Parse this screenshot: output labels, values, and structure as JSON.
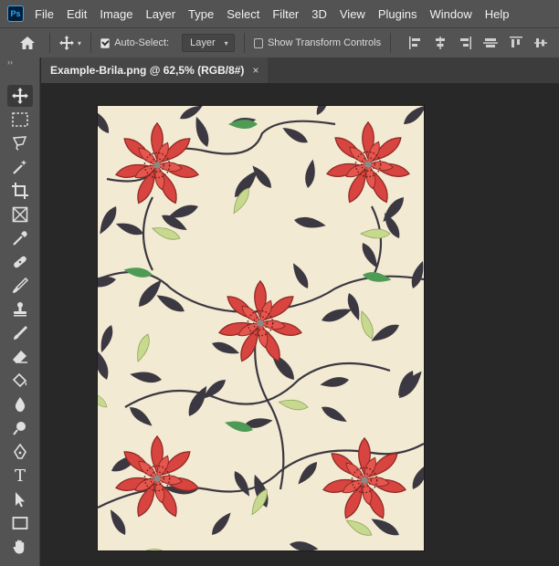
{
  "app": {
    "logo_text": "Ps"
  },
  "menu": [
    "File",
    "Edit",
    "Image",
    "Layer",
    "Type",
    "Select",
    "Filter",
    "3D",
    "View",
    "Plugins",
    "Window",
    "Help"
  ],
  "options_bar": {
    "auto_select_label": "Auto-Select:",
    "auto_select_checked": true,
    "target_value": "Layer",
    "show_transform_label": "Show Transform Controls",
    "show_transform_checked": false
  },
  "toolbar": {
    "grip": "››",
    "tools": [
      "move-tool-icon",
      "marquee-tool-icon",
      "lasso-tool-icon",
      "magic-wand-tool-icon",
      "crop-tool-icon",
      "frame-tool-icon",
      "eyedropper-tool-icon",
      "healing-brush-tool-icon",
      "brush-tool-icon",
      "clone-stamp-tool-icon",
      "history-brush-tool-icon",
      "eraser-tool-icon",
      "paint-bucket-tool-icon",
      "blur-tool-icon",
      "dodge-tool-icon",
      "pen-tool-icon",
      "type-tool-icon",
      "path-selection-tool-icon",
      "rectangle-tool-icon",
      "hand-tool-icon"
    ],
    "type_glyph": "T"
  },
  "document": {
    "tab_title": "Example-Brila.png @ 62,5% (RGB/8#)",
    "close_glyph": "×"
  },
  "colors": {
    "ui_bg": "#535353",
    "workspace": "#282828",
    "canvas_bg": "#f2ead2",
    "flower_red": "#d8443f",
    "leaf_dark": "#3b3842",
    "leaf_green": "#4f9a55",
    "leaf_light": "#c7d98f"
  }
}
